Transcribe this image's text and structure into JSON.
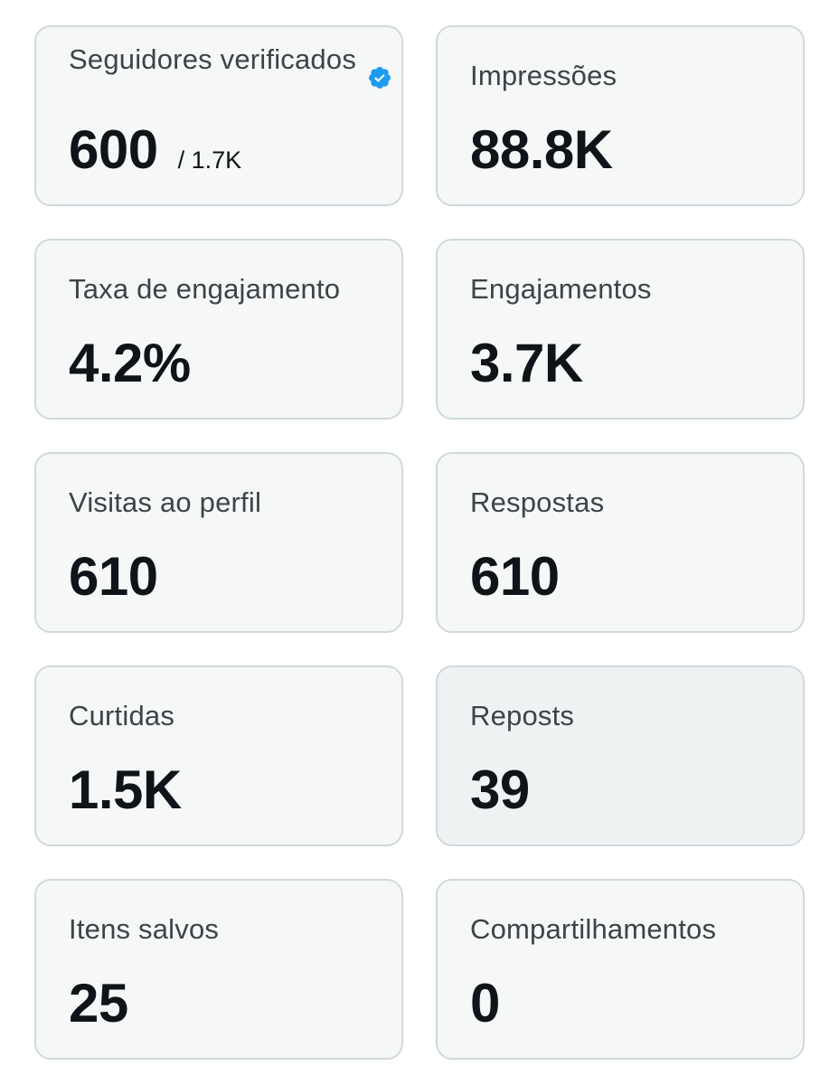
{
  "colors": {
    "card_background": "#f6f7f7",
    "card_background_hover": "#eff2f3",
    "card_border": "#cfd9de",
    "label_text": "#3d4348",
    "value_text": "#0f1419",
    "verified_badge": "#1d9bf0"
  },
  "cards": [
    {
      "label": "Seguidores verificados",
      "value": "600",
      "sub_value": "/ 1.7K",
      "icon": "verified-badge-icon"
    },
    {
      "label": "Impressões",
      "value": "88.8K"
    },
    {
      "label": "Taxa de engajamento",
      "value": "4.2%"
    },
    {
      "label": "Engajamentos",
      "value": "3.7K"
    },
    {
      "label": "Visitas ao perfil",
      "value": "610"
    },
    {
      "label": "Respostas",
      "value": "610"
    },
    {
      "label": "Curtidas",
      "value": "1.5K"
    },
    {
      "label": "Reposts",
      "value": "39"
    },
    {
      "label": "Itens salvos",
      "value": "25"
    },
    {
      "label": "Compartilhamentos",
      "value": "0"
    }
  ]
}
